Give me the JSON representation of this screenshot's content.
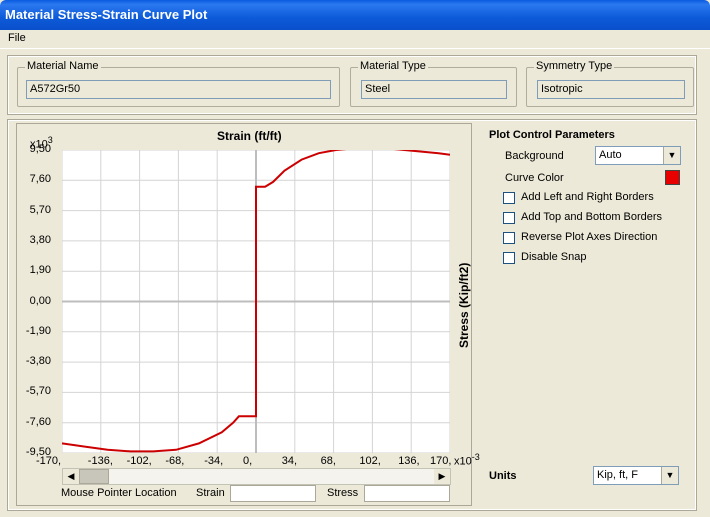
{
  "window": {
    "title": "Material Stress-Strain Curve Plot"
  },
  "menu": {
    "file": "File"
  },
  "material": {
    "name_label": "Material Name",
    "name_value": "A572Gr50",
    "type_label": "Material Type",
    "type_value": "Steel",
    "symmetry_label": "Symmetry Type",
    "symmetry_value": "Isotropic"
  },
  "plot": {
    "x_axis_title": "Strain    (ft/ft)",
    "y_axis_title": "Stress    (Kip/ft2)",
    "y_multiplier": "x10",
    "y_multiplier_exp": "3",
    "x_multiplier": "x10",
    "x_multiplier_exp": "-3",
    "y_ticks": [
      "9,50",
      "7,60",
      "5,70",
      "3,80",
      "1,90",
      "0,00",
      "-1,90",
      "-3,80",
      "-5,70",
      "-7,60",
      "-9,50"
    ],
    "x_ticks": [
      "-170,",
      "-136,",
      "-102,",
      "-68,",
      "-34,",
      "0,",
      "34,",
      "68,",
      "102,",
      "136,",
      "170,"
    ]
  },
  "chart_data": {
    "type": "line",
    "xlabel": "Strain (ft/ft)",
    "ylabel": "Stress (Kip/ft2)",
    "x_unit_multiplier": "x10^-3",
    "y_unit_multiplier": "x10^3",
    "xlim": [
      -170,
      170
    ],
    "ylim": [
      -9.5,
      9.5
    ],
    "grid": true,
    "series": [
      {
        "color": "#cc0000",
        "x": [
          -170,
          -150,
          -130,
          -110,
          -90,
          -70,
          -50,
          -30,
          -20,
          -15,
          -10,
          -2,
          -2,
          0,
          0,
          2,
          2,
          8,
          15,
          25,
          40,
          55,
          70,
          85,
          100,
          115,
          130,
          145,
          160,
          170
        ],
        "y": [
          -8.9,
          -9.1,
          -9.3,
          -9.4,
          -9.4,
          -9.3,
          -8.9,
          -8.2,
          -7.6,
          -7.2,
          -7.2,
          -7.2,
          -7.2,
          -7.2,
          7.2,
          7.2,
          7.2,
          7.2,
          7.5,
          8.2,
          8.9,
          9.3,
          9.5,
          9.6,
          9.65,
          9.6,
          9.5,
          9.4,
          9.3,
          9.2
        ]
      }
    ]
  },
  "status": {
    "pointer_label": "Mouse Pointer Location",
    "strain_label": "Strain",
    "stress_label": "Stress"
  },
  "controls": {
    "title": "Plot Control Parameters",
    "background_label": "Background",
    "background_value": "Auto",
    "curve_color_label": "Curve Color",
    "curve_color": "#e80000",
    "checkboxes": [
      "Add Left and Right Borders",
      "Add Top and Bottom Borders",
      "Reverse Plot Axes Direction",
      "Disable Snap"
    ],
    "units_label": "Units",
    "units_value": "Kip, ft, F"
  }
}
